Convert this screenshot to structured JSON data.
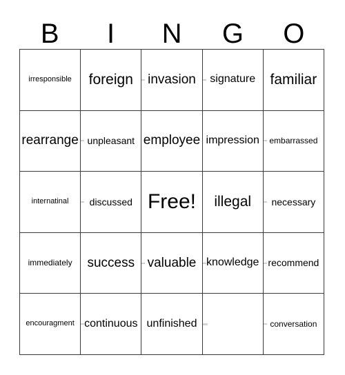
{
  "card": {
    "header_letters": [
      "B",
      "I",
      "N",
      "G",
      "O"
    ],
    "rows": [
      [
        {
          "text": "irresponsible",
          "size": "size-xs",
          "artifact": false
        },
        {
          "text": "foreign",
          "size": "size-xxl",
          "artifact": false
        },
        {
          "text": "invasion",
          "size": "size-xl",
          "artifact": true
        },
        {
          "text": "signature",
          "size": "size-lg",
          "artifact": true
        },
        {
          "text": "familiar",
          "size": "size-xxl",
          "artifact": false
        }
      ],
      [
        {
          "text": "rearrange",
          "size": "size-xl",
          "artifact": false
        },
        {
          "text": "unpleasant",
          "size": "size-md",
          "artifact": true
        },
        {
          "text": "employee",
          "size": "size-xl",
          "artifact": false
        },
        {
          "text": "impression",
          "size": "size-lg",
          "artifact": false
        },
        {
          "text": "embarrassed",
          "size": "size-sm",
          "artifact": true
        }
      ],
      [
        {
          "text": "internatinal",
          "size": "size-xs",
          "artifact": false
        },
        {
          "text": "discussed",
          "size": "size-md",
          "artifact": true
        },
        {
          "text": "Free!",
          "size": "size-free",
          "artifact": false
        },
        {
          "text": "illegal",
          "size": "size-xxl",
          "artifact": false
        },
        {
          "text": "necessary",
          "size": "size-md",
          "artifact": true
        }
      ],
      [
        {
          "text": "immediately",
          "size": "size-sm",
          "artifact": false
        },
        {
          "text": "success",
          "size": "size-xl",
          "artifact": false
        },
        {
          "text": "valuable",
          "size": "size-xl",
          "artifact": true
        },
        {
          "text": "knowledge",
          "size": "size-lg",
          "artifact": true
        },
        {
          "text": "recommend",
          "size": "size-md",
          "artifact": true
        }
      ],
      [
        {
          "text": "encouragment",
          "size": "size-xs",
          "artifact": false
        },
        {
          "text": "continuous",
          "size": "size-lg",
          "artifact": true
        },
        {
          "text": "unfinished",
          "size": "size-lg",
          "artifact": false
        },
        {
          "text": "",
          "size": "size-md",
          "artifact": false
        },
        {
          "text": "conversation",
          "size": "size-sm",
          "artifact": true
        }
      ]
    ]
  }
}
